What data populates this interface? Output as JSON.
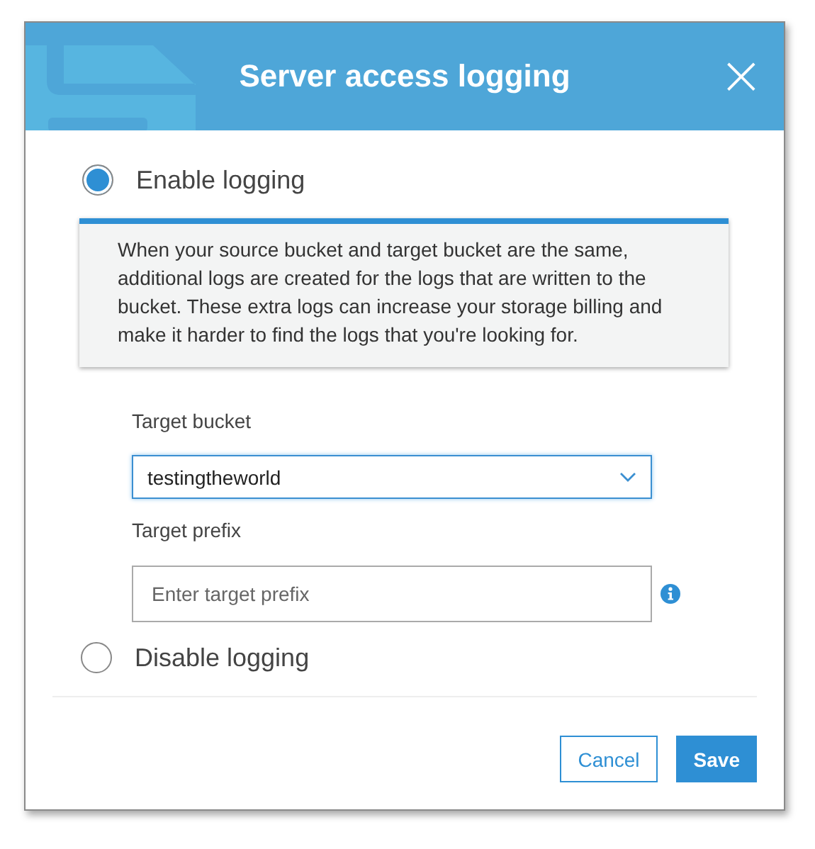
{
  "dialog": {
    "title": "Server access logging",
    "close": "×"
  },
  "options": [
    {
      "label": "Enable logging",
      "selected": true
    },
    {
      "label": "Disable logging",
      "selected": false
    }
  ],
  "note": "When your source bucket and target bucket are the same, additional logs are created for the logs that are written to the bucket. These extra logs can increase your storage billing and make it harder to find the logs that you're looking for.",
  "target_bucket": {
    "label": "Target bucket",
    "value": "testingtheworld"
  },
  "target_prefix": {
    "label": "Target prefix",
    "placeholder": "Enter target prefix"
  },
  "buttons": [
    {
      "label": "Cancel",
      "kind": "secondary"
    },
    {
      "label": "Save",
      "kind": "primary"
    }
  ]
}
